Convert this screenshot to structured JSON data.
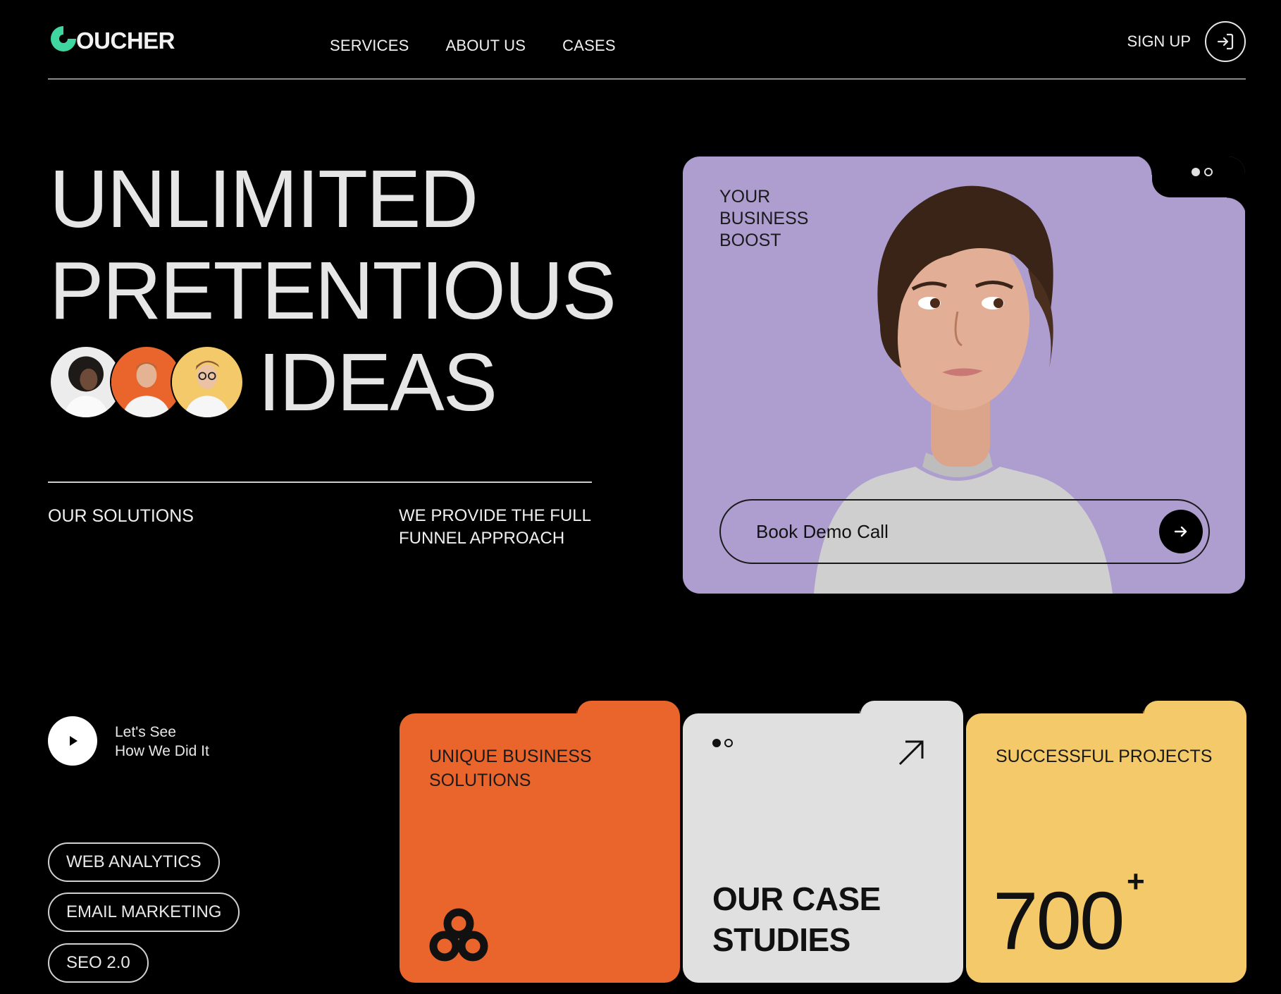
{
  "brand": {
    "logo_text": "OUCHER",
    "accent_color": "#3fd6a0"
  },
  "nav": {
    "items": [
      {
        "label": "SERVICES"
      },
      {
        "label": "ABOUT US"
      },
      {
        "label": "CASES"
      }
    ]
  },
  "header": {
    "signup_label": "SIGN UP",
    "signup_icon": "login-arrow-icon"
  },
  "hero": {
    "line1": "UNLIMITED",
    "line2": "PRETENTIOUS",
    "line3": "IDEAS",
    "avatar_colors": [
      "#e8e8e8",
      "#e9652b",
      "#f3c96a"
    ]
  },
  "solutions": {
    "label": "OUR SOLUTIONS",
    "description": "WE PROVIDE THE FULL FUNNEL APPROACH"
  },
  "feature_card": {
    "label": "YOUR BUSINESS BOOST",
    "cta_label": "Book Demo Call",
    "background_color": "#ad9ecf",
    "pager": {
      "count": 2,
      "active_index": 0
    }
  },
  "video": {
    "label_line1": "Let's See",
    "label_line2": "How We Did It"
  },
  "tags": [
    {
      "label": "WEB ANALYTICS"
    },
    {
      "label": "EMAIL MARKETING"
    },
    {
      "label": "SEO 2.0"
    }
  ],
  "cards": {
    "unique": {
      "title": "UNIQUE BUSINESS SOLUTIONS",
      "color": "#e9652b",
      "icon": "trefoil-icon"
    },
    "case_studies": {
      "title_line1": "OUR CASE",
      "title_line2": "STUDIES",
      "color": "#e0e0e0",
      "icon": "arrow-up-right-icon"
    },
    "projects": {
      "title": "SUCCESSFUL PROJECTS",
      "count": "700",
      "suffix": "+",
      "color": "#f3c96a"
    }
  }
}
